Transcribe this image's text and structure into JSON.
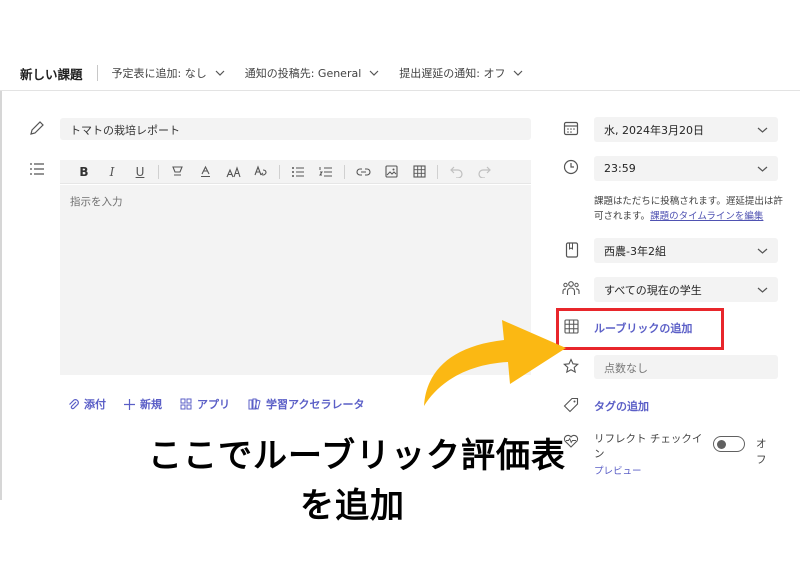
{
  "header": {
    "title": "新しい課題",
    "options": [
      {
        "label": "予定表に追加: なし"
      },
      {
        "label": "通知の投稿先: General"
      },
      {
        "label": "提出遅延の通知: オフ"
      }
    ]
  },
  "assignment": {
    "title_value": "トマトの栽培レポート",
    "instructions_placeholder": "指示を入力"
  },
  "attachments": {
    "attach": "添付",
    "new": "新規",
    "apps": "アプリ",
    "accelerator": "学習アクセラレータ"
  },
  "right": {
    "due_date": "水, 2024年3月20日",
    "due_time": "23:59",
    "note_text": "課題はただちに投稿されます。遅延提出は許可されます。",
    "note_link": "課題のタイムラインを編集",
    "class_name": "西農-3年2組",
    "students": "すべての現在の学生",
    "rubric": "ルーブリックの追加",
    "points": "点数なし",
    "tag": "タグの追加",
    "reflect": "リフレクト チェックイン",
    "preview": "プレビュー",
    "toggle_state": "オフ"
  },
  "annotation": {
    "line1": "ここでルーブリック評価表",
    "line2": "を追加"
  },
  "colors": {
    "accent": "#5b5fc7",
    "highlight_box": "#e8262b",
    "arrow": "#fbb813"
  }
}
